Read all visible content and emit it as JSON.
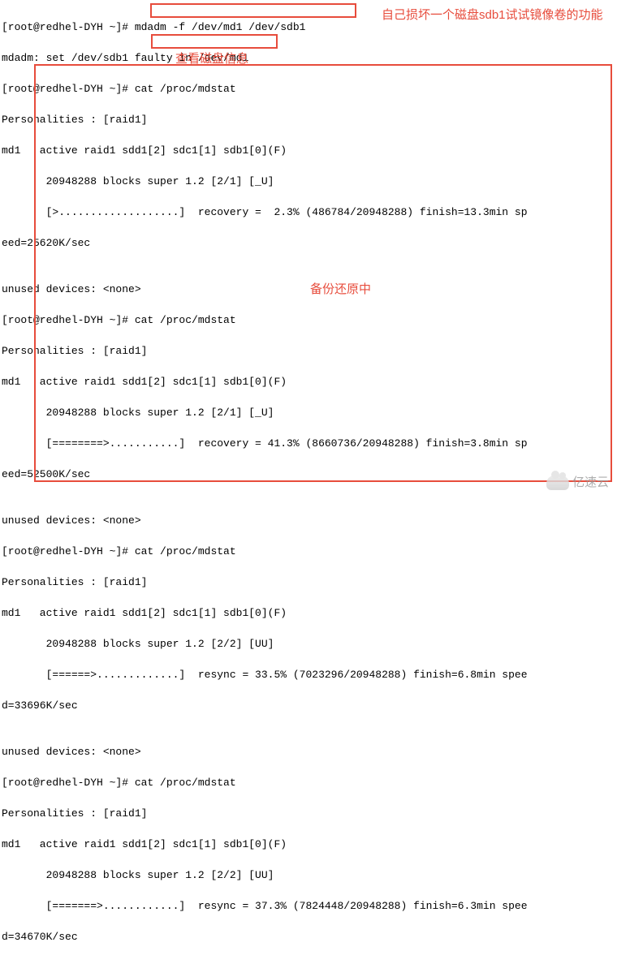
{
  "terminal": {
    "prompt": "[root@redhel-DYH ~]# ",
    "lines": [
      "[root@redhel-DYH ~]# mdadm -f /dev/md1 /dev/sdb1",
      "mdadm: set /dev/sdb1 faulty in /dev/md1",
      "[root@redhel-DYH ~]# cat /proc/mdstat",
      "Personalities : [raid1]",
      "md1   active raid1 sdd1[2] sdc1[1] sdb1[0](F)",
      "       20948288 blocks super 1.2 [2/1] [_U]",
      "       [>...................]  recovery =  2.3% (486784/20948288) finish=13.3min sp",
      "eed=25620K/sec",
      "",
      "unused devices: <none>",
      "[root@redhel-DYH ~]# cat /proc/mdstat",
      "Personalities : [raid1]",
      "md1   active raid1 sdd1[2] sdc1[1] sdb1[0](F)",
      "       20948288 blocks super 1.2 [2/1] [_U]",
      "       [========>...........]  recovery = 41.3% (8660736/20948288) finish=3.8min sp",
      "eed=52500K/sec",
      "",
      "unused devices: <none>",
      "[root@redhel-DYH ~]# cat /proc/mdstat",
      "Personalities : [raid1]",
      "md1   active raid1 sdd1[2] sdc1[1] sdb1[0](F)",
      "       20948288 blocks super 1.2 [2/2] [UU]",
      "       [======>.............]  resync = 33.5% (7023296/20948288) finish=6.8min spee",
      "d=33696K/sec",
      "",
      "unused devices: <none>",
      "[root@redhel-DYH ~]# cat /proc/mdstat",
      "Personalities : [raid1]",
      "md1   active raid1 sdd1[2] sdc1[1] sdb1[0](F)",
      "       20948288 blocks super 1.2 [2/2] [UU]",
      "       [=======>............]  resync = 37.3% (7824448/20948288) finish=6.3min spee",
      "d=34670K/sec"
    ]
  },
  "annotations": {
    "fault_disk": "自己损坏一个磁盘sdb1试试镜像卷的功能",
    "check_disk": "查看磁盘信息",
    "backup_restore": "备份还原中"
  },
  "watermark": {
    "text": "亿速云"
  }
}
